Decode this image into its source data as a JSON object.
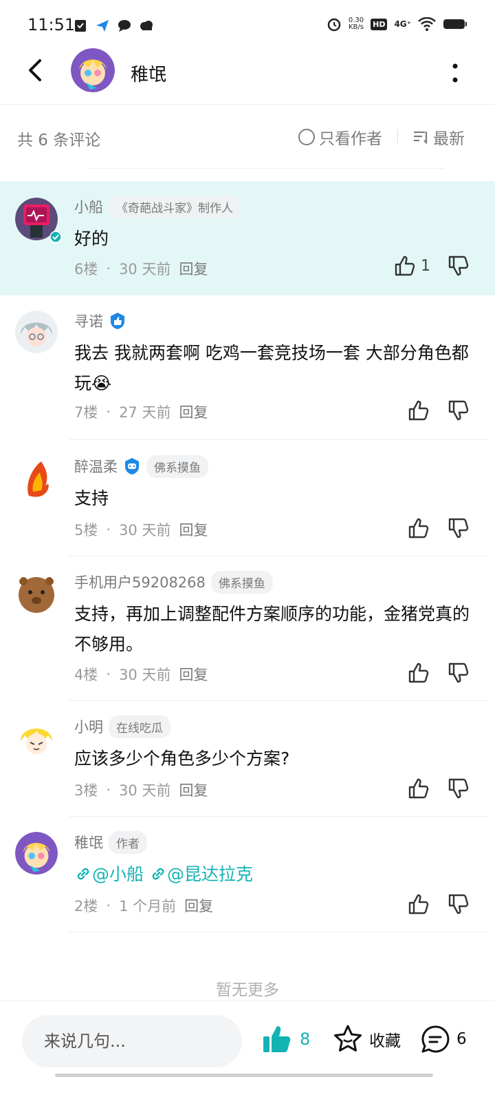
{
  "status": {
    "time": "11:51",
    "net_speed_value": "0.30",
    "net_speed_unit": "KB/s",
    "hd": "HD",
    "network": "4G⁺"
  },
  "header": {
    "title": "稚氓"
  },
  "count_bar": {
    "count_text": "共 6 条评论",
    "only_author": "只看作者",
    "sort": "最新"
  },
  "comments": [
    {
      "name": "小船",
      "tag": "《奇葩战斗家》制作人",
      "text": "好的",
      "floor": "6楼",
      "time": "30 天前",
      "reply": "回复",
      "likes": "1"
    },
    {
      "name": "寻诺",
      "text": "我去 我就两套啊 吃鸡一套竞技场一套 大部分角色都玩😭",
      "floor": "7楼",
      "time": "27 天前",
      "reply": "回复"
    },
    {
      "name": "醉温柔",
      "tag": "佛系摸鱼",
      "text": "支持",
      "floor": "5楼",
      "time": "30 天前",
      "reply": "回复"
    },
    {
      "name": "手机用户59208268",
      "tag": "佛系摸鱼",
      "text": "支持，再加上调整配件方案顺序的功能，金猪党真的不够用。",
      "floor": "4楼",
      "time": "30 天前",
      "reply": "回复"
    },
    {
      "name": "小明",
      "tag": "在线吃瓜",
      "text": "应该多少个角色多少个方案?",
      "floor": "3楼",
      "time": "30 天前",
      "reply": "回复"
    },
    {
      "name": "稚氓",
      "tag": "作者",
      "link1": "@小船",
      "link2": "@昆达拉克",
      "floor": "2楼",
      "time": "1 个月前",
      "reply": "回复"
    }
  ],
  "no_more": "暂无更多",
  "bottom": {
    "input_placeholder": "来说几句...",
    "likes": "8",
    "favorite": "收藏",
    "comments": "6"
  },
  "colors": {
    "accent": "#13b3b3",
    "highlight_bg": "#e4f7f7"
  }
}
